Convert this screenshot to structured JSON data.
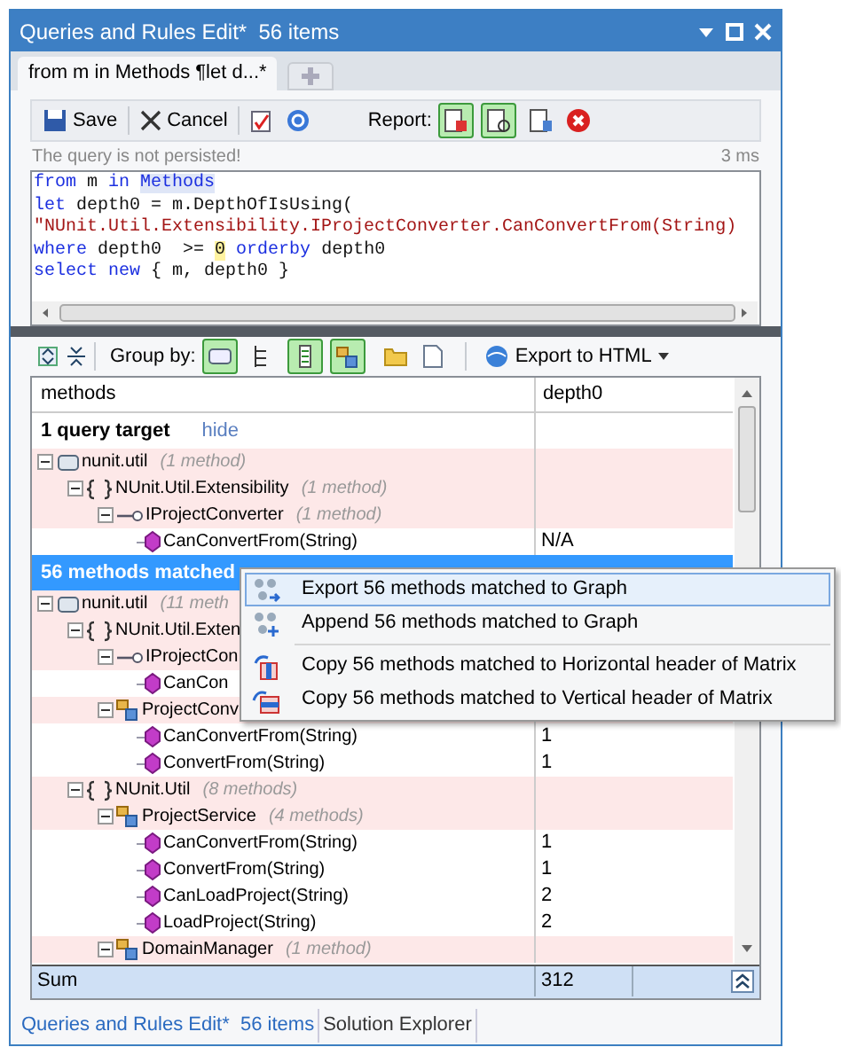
{
  "window": {
    "title": "Queries and Rules Edit*  56 items"
  },
  "doc_tabs": [
    {
      "label": "from m in Methods ¶let d...*",
      "selected": true
    }
  ],
  "toolbar": {
    "save": "Save",
    "cancel": "Cancel",
    "report_label": "Report:",
    "report_buttons": [
      {
        "selected": true
      },
      {
        "selected": true
      },
      {
        "selected": false
      }
    ]
  },
  "status": {
    "message": "The query is not persisted!",
    "time": "3 ms"
  },
  "code_lines": [
    [
      {
        "kind": "keyword",
        "text": "from"
      },
      {
        "kind": "plain",
        "text": " m "
      },
      {
        "kind": "keyword",
        "text": "in "
      },
      {
        "kind": "type",
        "text": "Methods"
      }
    ],
    [
      {
        "kind": "keyword",
        "text": "let"
      },
      {
        "kind": "plain",
        "text": " depth0 = m.DepthOfIsUsing("
      }
    ],
    [
      {
        "kind": "string",
        "text": "\"NUnit.Util.Extensibility.IProjectConverter.CanConvertFrom(String)"
      }
    ],
    [
      {
        "kind": "keyword",
        "text": "where"
      },
      {
        "kind": "plain",
        "text": " depth0  >= "
      },
      {
        "kind": "number",
        "text": "0"
      },
      {
        "kind": "keyword",
        "text": " orderby"
      },
      {
        "kind": "plain",
        "text": " depth0"
      }
    ],
    [
      {
        "kind": "keyword",
        "text": "select new"
      },
      {
        "kind": "plain",
        "text": " { m, depth0 }"
      }
    ]
  ],
  "results_toolbar": {
    "group_by_label": "Group by:",
    "group_buttons": [
      {
        "selected": true
      },
      {
        "selected": false
      },
      {
        "selected": true
      },
      {
        "selected": true
      }
    ],
    "export": "Export to HTML"
  },
  "grid": {
    "columns": [
      "methods",
      "depth0"
    ],
    "rows": [
      {
        "kind": "section",
        "label": "1 query target",
        "link": "hide",
        "selected": false
      },
      {
        "kind": "assembly",
        "name": "nunit.util",
        "count": "(1 method)",
        "expanded": true,
        "children": [
          {
            "kind": "namespace",
            "name": "NUnit.Util.Extensibility",
            "count": "(1 method)",
            "expanded": true,
            "children": [
              {
                "kind": "interface",
                "name": "IProjectConverter",
                "count": "(1 method)",
                "expanded": true,
                "children": [
                  {
                    "kind": "method",
                    "name": "CanConvertFrom(String)",
                    "value": "N/A"
                  }
                ]
              }
            ]
          }
        ]
      },
      {
        "kind": "section",
        "label": "56 methods matched",
        "selected": true
      },
      {
        "kind": "assembly",
        "name": "nunit.util",
        "count": "(11 meth",
        "expanded": true,
        "children": [
          {
            "kind": "namespace",
            "name": "NUnit.Util.Exten",
            "expanded": true,
            "children": [
              {
                "kind": "interface",
                "name": "IProjectCon",
                "expanded": true,
                "children": [
                  {
                    "kind": "method",
                    "name": "CanCon"
                  }
                ]
              },
              {
                "kind": "class",
                "name": "ProjectConv",
                "expanded": true,
                "children": [
                  {
                    "kind": "method",
                    "name": "CanConvertFrom(String)",
                    "value": "1"
                  },
                  {
                    "kind": "method",
                    "name": "ConvertFrom(String)",
                    "value": "1"
                  }
                ]
              }
            ]
          },
          {
            "kind": "namespace",
            "name": "NUnit.Util",
            "count": "(8 methods)",
            "expanded": true,
            "children": [
              {
                "kind": "class",
                "name": "ProjectService",
                "count": "(4 methods)",
                "expanded": true,
                "children": [
                  {
                    "kind": "method",
                    "name": "CanConvertFrom(String)",
                    "value": "1"
                  },
                  {
                    "kind": "method",
                    "name": "ConvertFrom(String)",
                    "value": "1"
                  },
                  {
                    "kind": "method",
                    "name": "CanLoadProject(String)",
                    "value": "2"
                  },
                  {
                    "kind": "method",
                    "name": "LoadProject(String)",
                    "value": "2"
                  }
                ]
              },
              {
                "kind": "class",
                "name": "DomainManager",
                "count": "(1 method)",
                "expanded": true
              }
            ]
          }
        ]
      }
    ],
    "sum": {
      "label": "Sum",
      "value": "312"
    }
  },
  "context_menu": [
    {
      "kind": "item",
      "label": "Export 56 methods matched to Graph",
      "selected": true
    },
    {
      "kind": "item",
      "label": "Append 56 methods matched to Graph",
      "selected": false
    },
    {
      "kind": "separator"
    },
    {
      "kind": "item",
      "label": "Copy 56 methods matched to Horizontal header of Matrix",
      "selected": false
    },
    {
      "kind": "item",
      "label": "Copy 56 methods matched to Vertical header of Matrix",
      "selected": false
    }
  ],
  "bottom_tabs": [
    {
      "label": "Queries and Rules Edit*  56 items",
      "selected": true
    },
    {
      "label": "Solution Explorer",
      "selected": false
    }
  ]
}
